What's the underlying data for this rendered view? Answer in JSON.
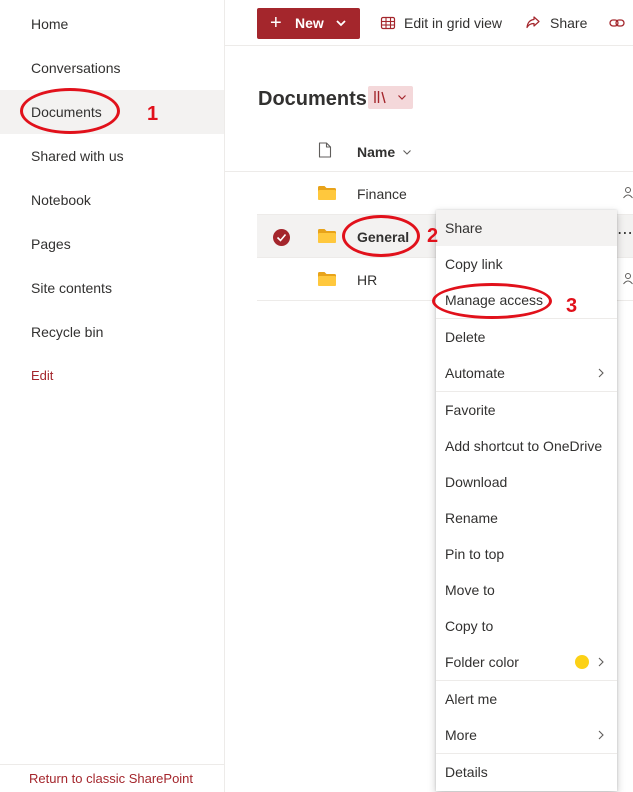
{
  "nav": {
    "items": [
      {
        "label": "Home"
      },
      {
        "label": "Conversations"
      },
      {
        "label": "Documents"
      },
      {
        "label": "Shared with us"
      },
      {
        "label": "Notebook"
      },
      {
        "label": "Pages"
      },
      {
        "label": "Site contents"
      },
      {
        "label": "Recycle bin"
      }
    ],
    "edit_label": "Edit",
    "footer": "Return to classic SharePoint"
  },
  "cmdbar": {
    "new_label": "New",
    "grid_label": "Edit in grid view",
    "share_label": "Share"
  },
  "page": {
    "title": "Documents"
  },
  "list": {
    "name_header": "Name",
    "rows": [
      {
        "name": "Finance"
      },
      {
        "name": "General"
      },
      {
        "name": "HR"
      }
    ]
  },
  "menu": {
    "items": [
      "Share",
      "Copy link",
      "Manage access",
      "Delete",
      "Automate",
      "Favorite",
      "Add shortcut to OneDrive",
      "Download",
      "Rename",
      "Pin to top",
      "Move to",
      "Copy to",
      "Folder color",
      "Alert me",
      "More",
      "Details"
    ],
    "folder_color_swatch": "#fcd116"
  },
  "annotations": {
    "step1": "1",
    "step2": "2",
    "step3": "3",
    "color": "#e1111b"
  },
  "theme": {
    "accent": "#a4262c",
    "folder": "#ffb900"
  }
}
